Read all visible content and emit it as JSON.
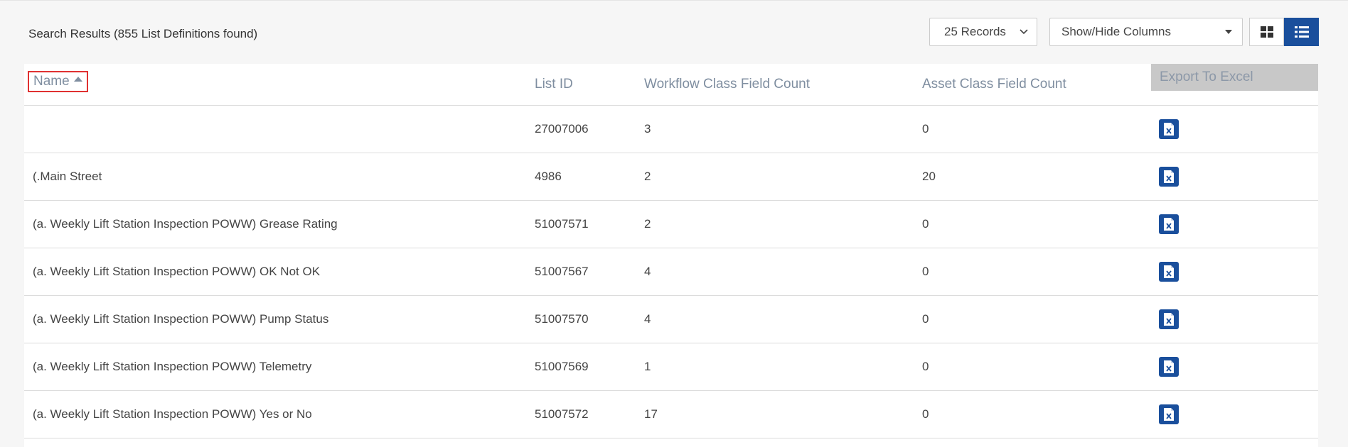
{
  "toolbar": {
    "result_summary": "Search Results (855 List Definitions found)",
    "records_select": {
      "value": "25 Records"
    },
    "columns_select": {
      "value": "Show/Hide Columns"
    },
    "grid_view_icon": "grid-icon",
    "list_view_icon": "list-icon"
  },
  "table": {
    "headers": {
      "name": "Name",
      "list_id": "List ID",
      "workflow_count": "Workflow Class Field Count",
      "asset_count": "Asset Class Field Count",
      "export": "Export To Excel"
    },
    "rows": [
      {
        "name": "",
        "list_id": "27007006",
        "workflow_count": "3",
        "asset_count": "0"
      },
      {
        "name": "(.Main Street",
        "list_id": "4986",
        "workflow_count": "2",
        "asset_count": "20"
      },
      {
        "name": "(a. Weekly Lift Station Inspection POWW) Grease Rating",
        "list_id": "51007571",
        "workflow_count": "2",
        "asset_count": "0"
      },
      {
        "name": "(a. Weekly Lift Station Inspection POWW) OK Not OK",
        "list_id": "51007567",
        "workflow_count": "4",
        "asset_count": "0"
      },
      {
        "name": "(a. Weekly Lift Station Inspection POWW) Pump Status",
        "list_id": "51007570",
        "workflow_count": "4",
        "asset_count": "0"
      },
      {
        "name": "(a. Weekly Lift Station Inspection POWW) Telemetry",
        "list_id": "51007569",
        "workflow_count": "1",
        "asset_count": "0"
      },
      {
        "name": "(a. Weekly Lift Station Inspection POWW) Yes or No",
        "list_id": "51007572",
        "workflow_count": "17",
        "asset_count": "0"
      }
    ]
  },
  "colors": {
    "accent": "#1a4f9c",
    "header_text": "#7f8ea0",
    "sort_highlight_border": "#e03131"
  }
}
